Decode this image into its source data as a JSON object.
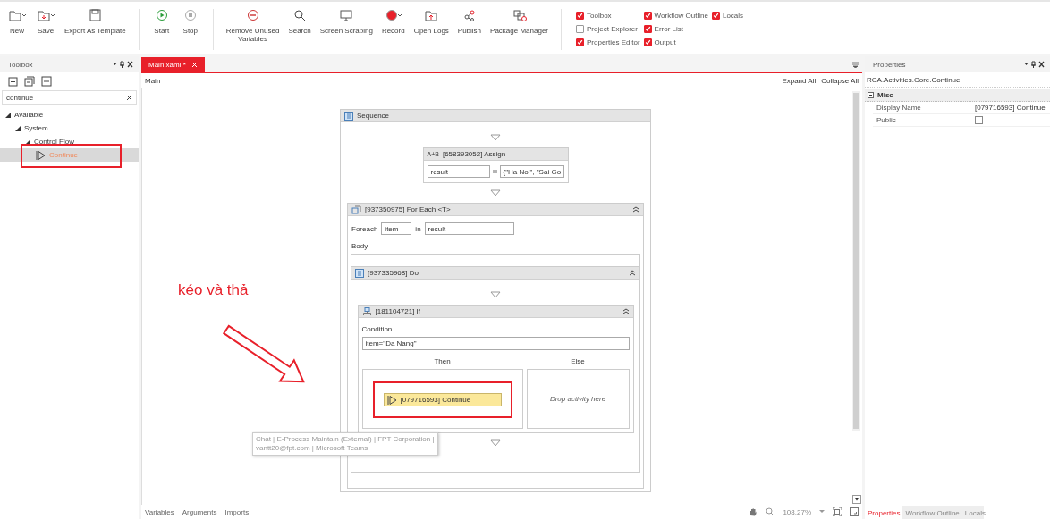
{
  "toolbar": [
    {
      "items": [
        {
          "lines": [
            "New"
          ]
        },
        {
          "lines": [
            "Save"
          ]
        },
        {
          "lines": [
            "Export As Template"
          ]
        }
      ]
    },
    {
      "items": [
        {
          "lines": [
            "Start"
          ]
        },
        {
          "lines": [
            "Stop"
          ]
        }
      ]
    },
    {
      "items": [
        {
          "lines": [
            "Remove Unused",
            "Variables"
          ]
        },
        {
          "lines": [
            "Search"
          ]
        },
        {
          "lines": [
            "Screen Scraping"
          ]
        },
        {
          "lines": [
            "Record"
          ]
        },
        {
          "lines": [
            "Open Logs"
          ]
        },
        {
          "lines": [
            "Publish"
          ]
        },
        {
          "lines": [
            "Package Manager"
          ]
        }
      ]
    }
  ],
  "panel_toggles": [
    [
      {
        "label": "Toolbox",
        "checked": true
      },
      {
        "label": "Project Explorer",
        "checked": false
      },
      {
        "label": "Properties Editor",
        "checked": true
      }
    ],
    [
      {
        "label": "Workflow Outline",
        "checked": true
      },
      {
        "label": "Error List",
        "checked": true
      },
      {
        "label": "Output",
        "checked": true
      }
    ],
    [
      {
        "label": "Locals",
        "checked": true
      }
    ]
  ],
  "toolbox": {
    "title": "Toolbox",
    "search": {
      "value": "continue"
    },
    "tree": [
      {
        "label": "Available",
        "expanded": true,
        "children": [
          {
            "label": "System",
            "expanded": true,
            "children": [
              {
                "label": "Control Flow",
                "expanded": true,
                "children": [
                  {
                    "label": "Continue",
                    "selected": true
                  }
                ]
              }
            ]
          }
        ]
      }
    ]
  },
  "tabs": [
    {
      "label": "Main.xaml *",
      "selected": true
    }
  ],
  "breadcrumb": "Main",
  "expand_all": "Expand All",
  "collapse_all": "Collapse All",
  "workflow": {
    "sequence_title": "Sequence",
    "assign": {
      "badge": "A+B",
      "title": "[658393052] Assign",
      "to": "result",
      "value": "{\"Ha Noi\", \"Sai Go"
    },
    "foreach": {
      "title": "[937350975] For Each <T>",
      "foreach_label": "Foreach",
      "item": "item",
      "in_label": "in",
      "values": "result",
      "body_label": "Body"
    },
    "do": {
      "title": "[937335968] Do"
    },
    "if": {
      "title": "[181104721] If",
      "condition_label": "Condition",
      "condition": "item=\"Da Nang\"",
      "then_label": "Then",
      "else_label": "Else",
      "then_activity": "[079716593] Continue",
      "else_placeholder": "Drop activity here"
    }
  },
  "annotation": "kéo và thả",
  "tooltip": [
    "Chat | E-Process Maintain (External) | FPT Corporation |",
    "vantt20@fpt.com | Microsoft Teams"
  ],
  "bottom_tabs": [
    "Variables",
    "Arguments",
    "Imports"
  ],
  "zoom": "108.27%",
  "properties": {
    "title": "Properties",
    "type_name": "RCA.Activities.Core.Continue",
    "category": "Misc",
    "rows": [
      {
        "name": "Display Name",
        "kind": "text",
        "value": "[079716593] Continue"
      },
      {
        "name": "Public",
        "kind": "checkbox",
        "checked": false
      }
    ]
  },
  "right_tabs": [
    {
      "label": "Properties",
      "selected": true
    },
    {
      "label": "Workflow Outline",
      "selected": false
    },
    {
      "label": "Locals",
      "selected": false
    }
  ]
}
